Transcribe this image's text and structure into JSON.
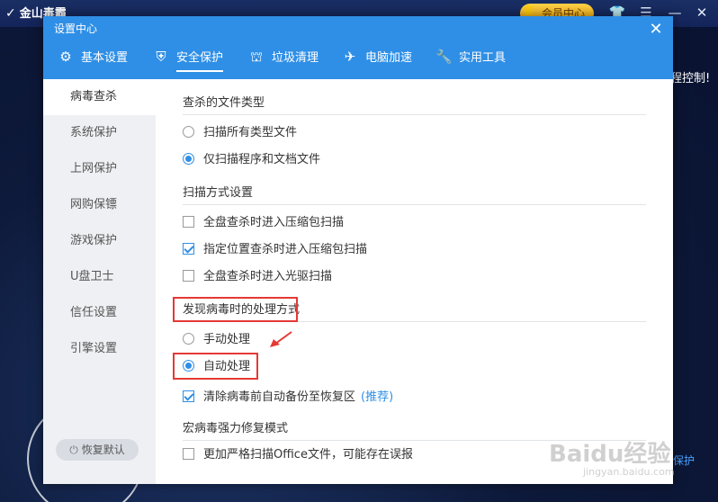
{
  "background": {
    "app_name": "金山毒霸",
    "member_label": "会员中心",
    "right_text": "程控制!",
    "right_link": "保护"
  },
  "dialog": {
    "title": "设置中心",
    "tabs": [
      {
        "label": "基本设置",
        "icon": "gear-icon"
      },
      {
        "label": "安全保护",
        "icon": "shield-icon"
      },
      {
        "label": "垃圾清理",
        "icon": "broom-icon"
      },
      {
        "label": "电脑加速",
        "icon": "rocket-icon"
      },
      {
        "label": "实用工具",
        "icon": "wrench-icon"
      }
    ],
    "active_tab": "安全保护"
  },
  "leftnav": {
    "items": [
      "病毒查杀",
      "系统保护",
      "上网保护",
      "网购保镖",
      "游戏保护",
      "U盘卫士",
      "信任设置",
      "引擎设置"
    ],
    "active": "病毒查杀",
    "restore_label": "恢复默认"
  },
  "content": {
    "file_types": {
      "title": "查杀的文件类型",
      "options": [
        "扫描所有类型文件",
        "仅扫描程序和文档文件"
      ],
      "selected": "仅扫描程序和文档文件"
    },
    "scan_mode": {
      "title": "扫描方式设置",
      "options": [
        {
          "label": "全盘查杀时进入压缩包扫描",
          "checked": false
        },
        {
          "label": "指定位置查杀时进入压缩包扫描",
          "checked": true
        },
        {
          "label": "全盘查杀时进入光驱扫描",
          "checked": false
        }
      ]
    },
    "virus_handling": {
      "title": "发现病毒时的处理方式",
      "options": [
        "手动处理",
        "自动处理"
      ],
      "selected": "自动处理",
      "backup": {
        "label": "清除病毒前自动备份至恢复区",
        "checked": true,
        "tag": "(推荐)"
      }
    },
    "macro": {
      "title": "宏病毒强力修复模式",
      "option": {
        "label": "更加严格扫描Office文件，可能存在误报",
        "checked": false
      }
    }
  },
  "watermark": {
    "main": "Baidu经验",
    "sub": "jingyan.baidu.com"
  },
  "colors": {
    "accent": "#2f8fe6",
    "highlight": "#e53935"
  }
}
